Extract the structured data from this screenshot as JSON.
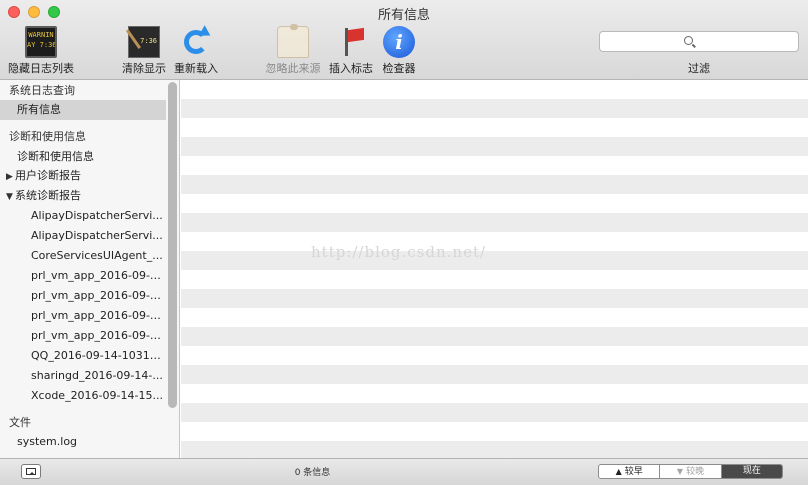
{
  "window": {
    "title": "所有信息"
  },
  "toolbar": {
    "items": [
      {
        "label": "隐藏日志列表",
        "icon": "console-warning-icon",
        "screen": "WARNIN\nAY 7:36"
      },
      {
        "label": "清除显示",
        "icon": "clear-broom-icon",
        "screen": "7:36"
      },
      {
        "label": "重新载入",
        "icon": "reload-icon"
      },
      {
        "label": "忽略此来源",
        "icon": "ignore-sender-icon"
      },
      {
        "label": "插入标志",
        "icon": "flag-icon"
      },
      {
        "label": "检查器",
        "icon": "info-icon",
        "glyph": "i"
      }
    ],
    "search": {
      "placeholder": "",
      "value": ""
    },
    "filter_label": "过滤"
  },
  "sidebar": {
    "sections": [
      {
        "header": "系统日志查询",
        "items": [
          {
            "label": "所有信息",
            "selected": true
          }
        ]
      },
      {
        "header": "诊断和使用信息",
        "items": [
          {
            "label": "诊断和使用信息"
          }
        ]
      },
      {
        "group": "用户诊断报告",
        "expanded": false
      },
      {
        "group": "系统诊断报告",
        "expanded": true,
        "items": [
          "AlipayDispatcherServi...",
          "AlipayDispatcherServi...",
          "CoreServicesUIAgent_...",
          "prl_vm_app_2016-09-1...",
          "prl_vm_app_2016-09-1...",
          "prl_vm_app_2016-09-1...",
          "prl_vm_app_2016-09-1...",
          "QQ_2016-09-14-10310...",
          "sharingd_2016-09-14-...",
          "Xcode_2016-09-14-15..."
        ]
      },
      {
        "header": "文件",
        "items": [
          {
            "label": "system.log"
          }
        ]
      }
    ],
    "tri_collapsed": "▶",
    "tri_expanded": "▼"
  },
  "log": {
    "watermark": "http://blog.csdn.net/"
  },
  "status": {
    "message_count": "0 条信息",
    "nav": [
      {
        "label": "较早",
        "arrow": "▲",
        "state": "normal"
      },
      {
        "label": "较晚",
        "arrow": "▼",
        "state": "disabled"
      },
      {
        "label": "现在",
        "state": "active"
      }
    ]
  },
  "colors": {
    "selection": "#d4d4d4",
    "accent": "#2b8ee8",
    "stripe": "#ececec"
  }
}
